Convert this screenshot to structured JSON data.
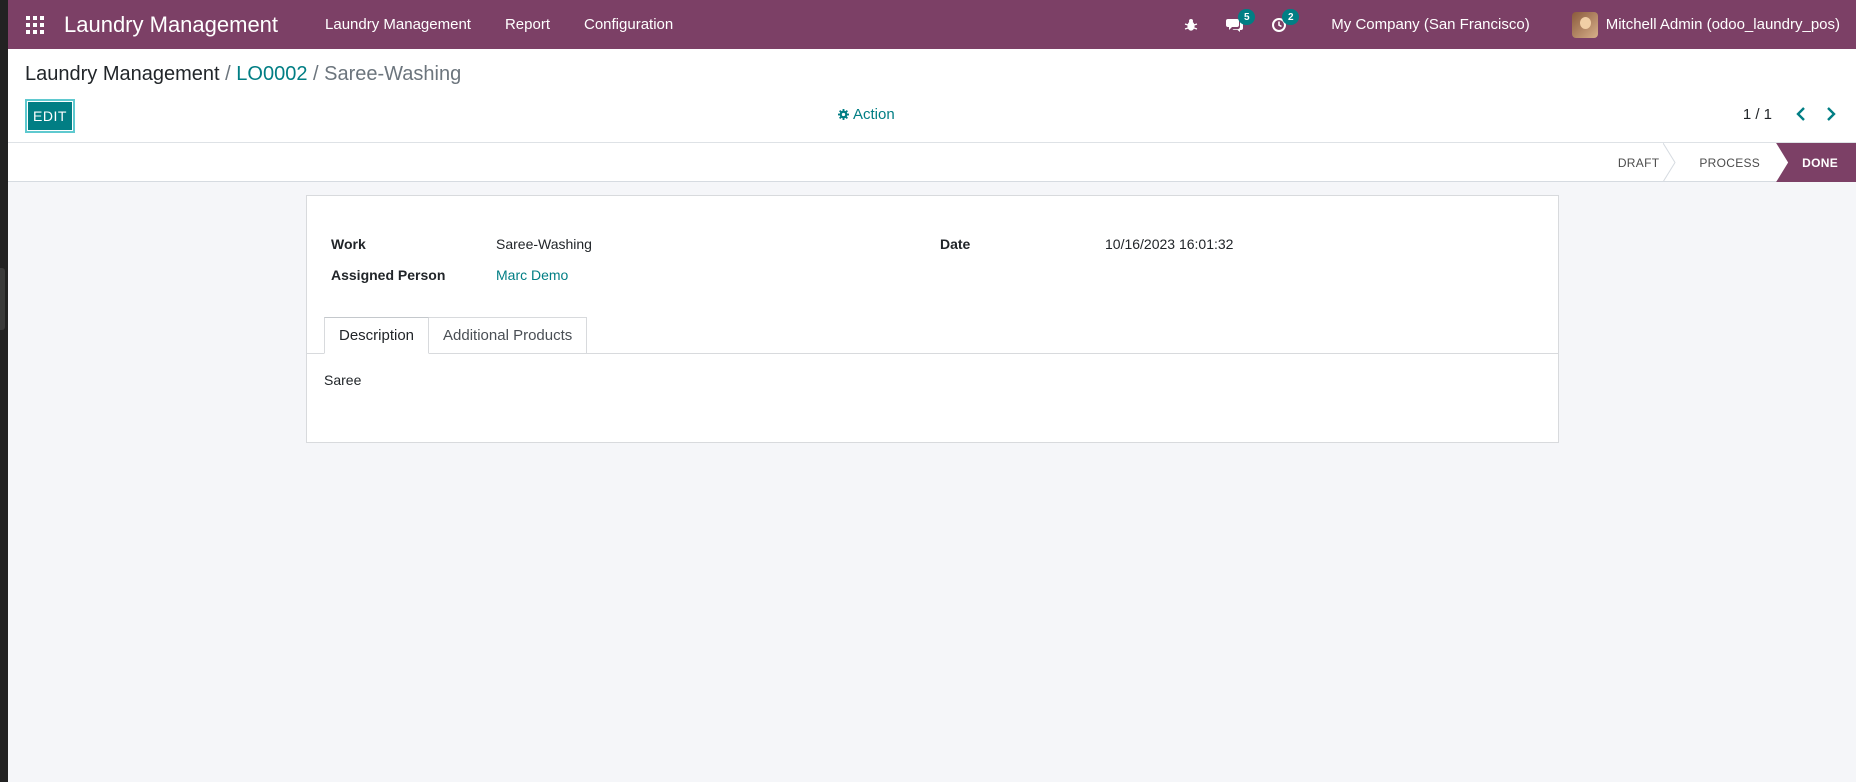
{
  "navbar": {
    "brand": "Laundry Management",
    "menu": [
      "Laundry Management",
      "Report",
      "Configuration"
    ],
    "messages_badge": "5",
    "activities_badge": "2",
    "company": "My Company (San Francisco)",
    "user": "Mitchell Admin (odoo_laundry_pos)"
  },
  "breadcrumb": {
    "root": "Laundry Management",
    "sep": "/",
    "order": "LO0002",
    "current": "Saree-Washing"
  },
  "control": {
    "edit_label": "EDIT",
    "action_label": "Action",
    "pager": "1 / 1"
  },
  "statusbar": {
    "stages": [
      "DRAFT",
      "PROCESS",
      "DONE"
    ],
    "active": "DONE"
  },
  "form": {
    "work_label": "Work",
    "work_value": "Saree-Washing",
    "assigned_label": "Assigned Person",
    "assigned_value": "Marc Demo",
    "date_label": "Date",
    "date_value": "10/16/2023 16:01:32"
  },
  "tabs": {
    "description": "Description",
    "additional": "Additional Products",
    "active": "Description"
  },
  "description_text": "Saree",
  "colors": {
    "brand": "#7c4066",
    "accent": "#017e84"
  }
}
